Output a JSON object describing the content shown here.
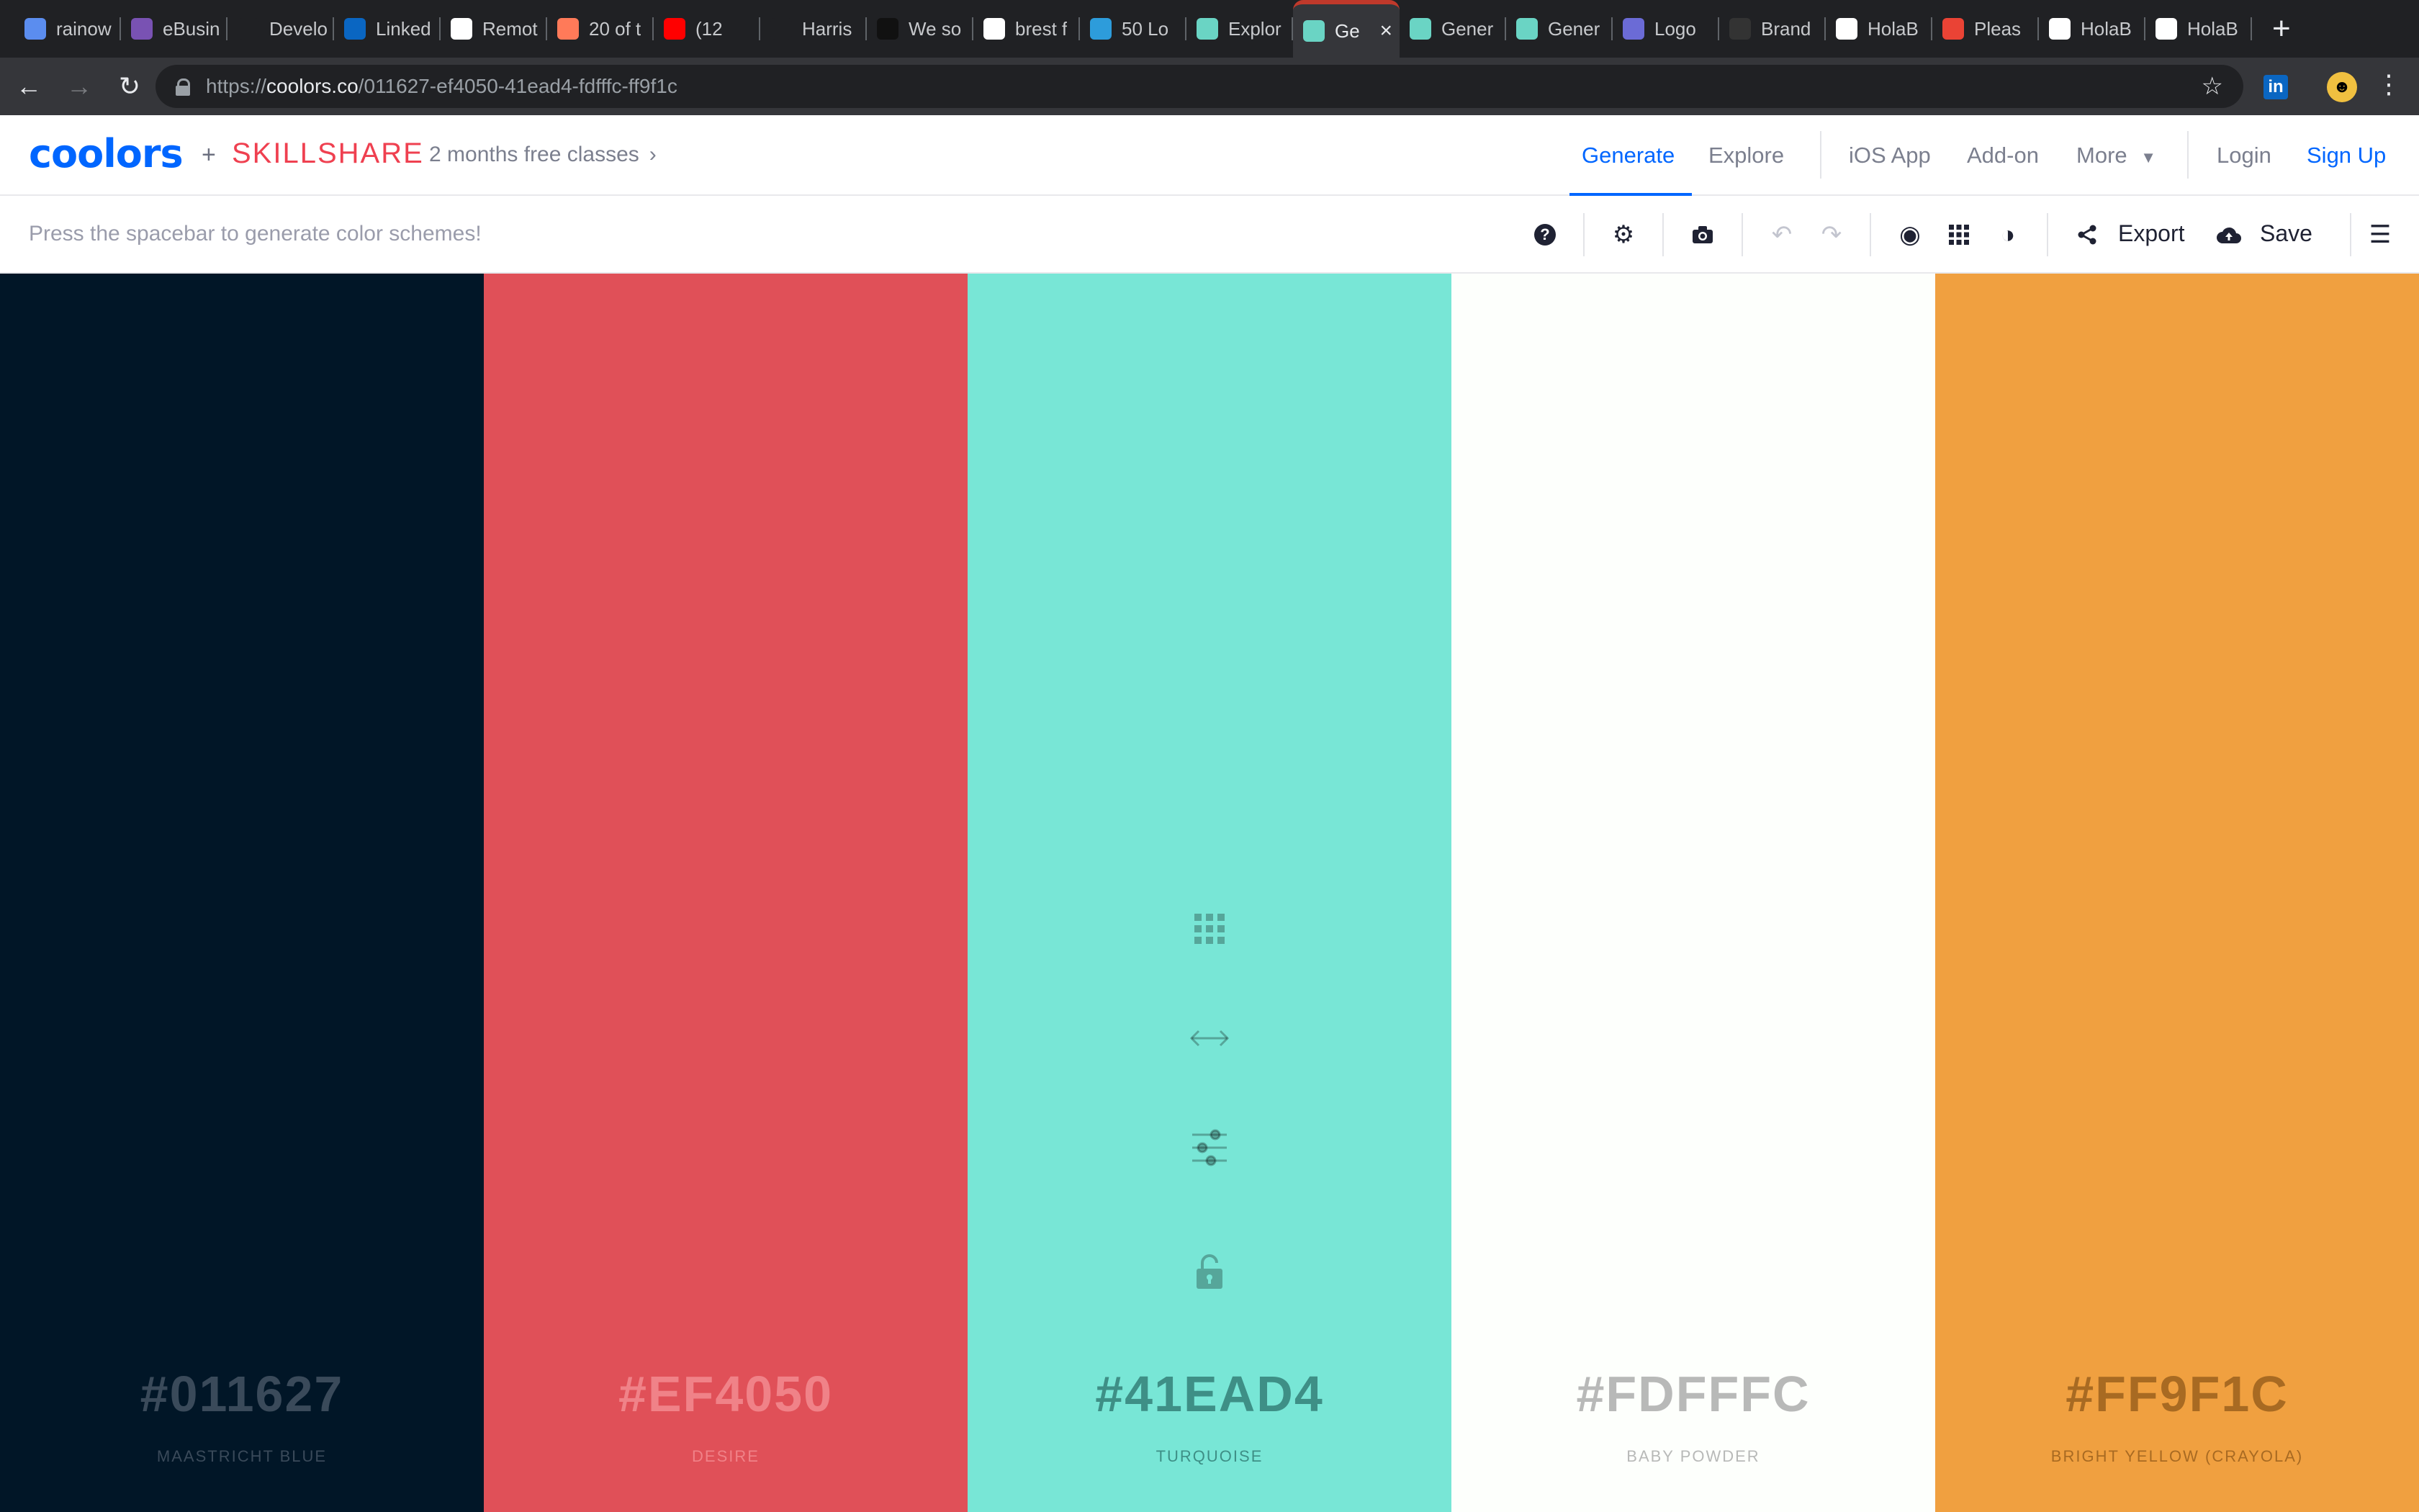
{
  "browser": {
    "tabs": [
      {
        "title": "rainow",
        "icon": "rainbow-favicon-icon",
        "color": "#5b8def"
      },
      {
        "title": "eBusin",
        "icon": "bootstrap-favicon-icon",
        "color": "#7952b3"
      },
      {
        "title": "Develo",
        "icon": "blank-favicon-icon",
        "color": "#202124"
      },
      {
        "title": "Linked",
        "icon": "linkedin-favicon-icon",
        "color": "#0a66c2"
      },
      {
        "title": "Remot",
        "icon": "remote-favicon-icon",
        "color": "#ffffff"
      },
      {
        "title": "20 of t",
        "icon": "hubspot-favicon-icon",
        "color": "#ff7a59"
      },
      {
        "title": "(12",
        "icon": "youtube-favicon-icon",
        "color": "#ff0000"
      },
      {
        "title": "Harris",
        "icon": "blank-favicon-icon",
        "color": "#202124"
      },
      {
        "title": "We so",
        "icon": "page-favicon-icon",
        "color": "#111111"
      },
      {
        "title": "brest f",
        "icon": "google-favicon-icon",
        "color": "#ffffff"
      },
      {
        "title": "50 Lo",
        "icon": "dh-favicon-icon",
        "color": "#2d9cdb"
      },
      {
        "title": "Explor",
        "icon": "coolors-favicon-icon",
        "color": "#6ad4c4"
      },
      {
        "title": "Ge",
        "icon": "coolors-favicon-icon",
        "color": "#6ad4c4",
        "active": true
      },
      {
        "title": "Gener",
        "icon": "coolors-favicon-icon",
        "color": "#6ad4c4"
      },
      {
        "title": "Gener",
        "icon": "coolors-favicon-icon",
        "color": "#6ad4c4"
      },
      {
        "title": "Logo",
        "icon": "logo-favicon-icon",
        "color": "#6b6bd6"
      },
      {
        "title": "Brand",
        "icon": "sb-favicon-icon",
        "color": "#333333"
      },
      {
        "title": "HolaB",
        "icon": "hola-favicon-icon",
        "color": "#ffffff"
      },
      {
        "title": "Pleas",
        "icon": "gmail-favicon-icon",
        "color": "#ea4335"
      },
      {
        "title": "HolaB",
        "icon": "hola-favicon-icon",
        "color": "#ffffff"
      },
      {
        "title": "HolaB",
        "icon": "hola-favicon-icon",
        "color": "#ffffff"
      }
    ],
    "url_prefix": "https://",
    "url_host": "coolors.co",
    "url_path": "/011627-ef4050-41ead4-fdfffc-ff9f1c"
  },
  "header": {
    "logo": "coolors",
    "plus": "+",
    "partner": "SKILLSHARE",
    "promo": "2 months free classes",
    "nav": {
      "generate": "Generate",
      "explore": "Explore",
      "ios_app": "iOS App",
      "addon": "Add-on",
      "more": "More",
      "login": "Login",
      "signup": "Sign Up"
    }
  },
  "toolbar": {
    "hint": "Press the spacebar to generate color schemes!",
    "export_label": "Export",
    "save_label": "Save"
  },
  "palette": [
    {
      "hex": "#011627",
      "name": "MAASTRICHT BLUE",
      "bg": "#011627",
      "fg": "#3a4a5a"
    },
    {
      "hex": "#EF4050",
      "name": "DESIRE",
      "bg": "#e05058",
      "fg": "#f08288"
    },
    {
      "hex": "#41EAD4",
      "name": "TURQUOISE",
      "bg": "#78e6d6",
      "fg": "#3e8f86"
    },
    {
      "hex": "#FDFFFC",
      "name": "BABY POWDER",
      "bg": "#fdfffc",
      "fg": "#b8b9b8"
    },
    {
      "hex": "#FF9F1C",
      "name": "BRIGHT YELLOW (CRAYOLA)",
      "bg": "#f0a040",
      "fg": "#a86a22"
    }
  ]
}
